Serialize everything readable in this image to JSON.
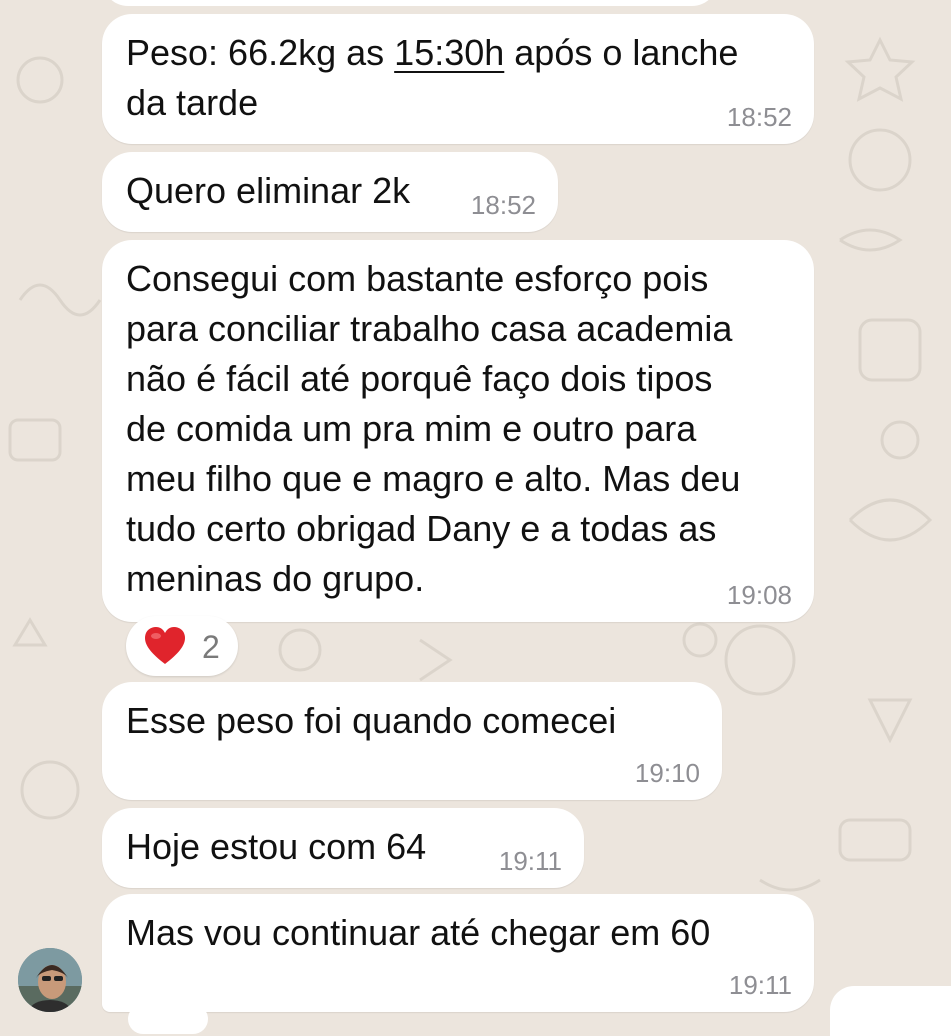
{
  "messages": [
    {
      "text_before": "Peso: 66.2kg as ",
      "linked_time": "15:30h",
      "text_after": " após o lanche\nda tarde",
      "time": "18:52"
    },
    {
      "text": "Quero eliminar 2k",
      "time": "18:52"
    },
    {
      "text": "Consegui com bastante esforço pois\npara conciliar trabalho casa academia\nnão é fácil até porquê faço dois tipos\nde comida um pra mim e outro para\nmeu filho que e magro e alto. Mas deu\ntudo certo obrigad Dany e a todas as\nmeninas do grupo.",
      "time": "19:08",
      "reaction": {
        "emoji": "heart-icon",
        "count": "2",
        "color": "#E0242C"
      }
    },
    {
      "text": "Esse peso foi quando comecei",
      "time": "19:10"
    },
    {
      "text": "Hoje estou com 64",
      "time": "19:11"
    },
    {
      "text": "Mas vou continuar até chegar em 60",
      "time": "19:11"
    }
  ],
  "colors": {
    "background": "#ECE5DD",
    "bubble": "#FFFFFF",
    "timestamp": "#8E8E93"
  }
}
